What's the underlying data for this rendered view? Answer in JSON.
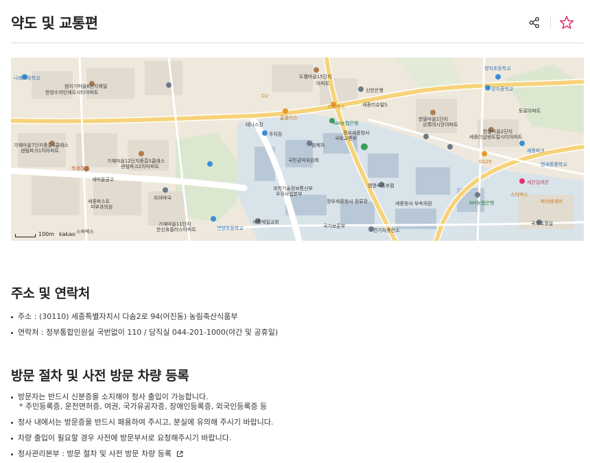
{
  "header": {
    "title": "약도 및 교통편",
    "share_icon": "share-icon",
    "favorite_icon": "star-outline-icon",
    "accent_color": "#e8306e"
  },
  "map": {
    "labels": [
      "나래초등학교",
      "범지기마을6단지제일",
      "한양수자인에듀시티아파트",
      "도램마을15단지",
      "아파트",
      "세종리슈빌S",
      "신한은행",
      "스타벅스",
      "NH농협은행",
      "홈플러스",
      "테니스장",
      "주차장",
      "가재마을7단지중흥S클래스",
      "센텀파크1차아파트",
      "가재마을12단지중흥S클래스",
      "센텀파크2차아파트",
      "뚜레쥬르",
      "새마을금고",
      "차야약국",
      "세종파스트",
      "피부과의원",
      "가재마을11단지",
      "한신휴플러스아파트",
      "연양초등학교",
      "세종제일교회",
      "스파렉스",
      "정부세종청사",
      "국토교통부",
      "범제처",
      "국민권익위원회",
      "과학기술정보통신부",
      "우정사업본부",
      "정부세종청사 정류장",
      "엠앤숙동포럼",
      "국가보훈부",
      "전기차충전소",
      "세종청사 부속의원",
      "한뜰마을1단지",
      "상록데시앙아파트",
      "한뜰마을2단지",
      "세종더샵센트럴시티아파트",
      "GS25",
      "세종파크",
      "엔세종중학교",
      "세븐일레븐",
      "스타벅스",
      "NH농협은행",
      "국무조정실",
      "양지초등학교",
      "양지중학교",
      "토로아파트",
      "파리바게뜨",
      "CU"
    ],
    "scale_label": "100m",
    "brand": "kakao"
  },
  "contact": {
    "heading": "주소 및 연락처",
    "address": "주소 : (30110) 세종특별자치시 다솜2로 94(어진동) 농림축산식품부",
    "phone": "연락처 : 정부통합민원실 국번없이 110 / 당직실 044-201-1000(야간 및 공휴일)"
  },
  "visit": {
    "heading": "방문 절차 및 사전 방문 차량 등록",
    "item1": "방문자는 반드시 신분증을 소지해야 청사 출입이 가능합니다.",
    "item1_sub": "* 주민등록증, 운전면허증, 여권, 국가유공자증, 장애인등록증, 외국인등록증 등",
    "item2": "청사 내에서는 방문증을 반드시 패용하여 주시고, 분실에 유의해 주시기 바랍니다.",
    "item3": "차량 출입이 필요할 경우 사전에 방문부서로 요청해주시기 바랍니다.",
    "item4": "청사관리본부 : 방문 절차 및 사전 방문 차량 등록",
    "external_link_icon": "external-link-icon"
  }
}
